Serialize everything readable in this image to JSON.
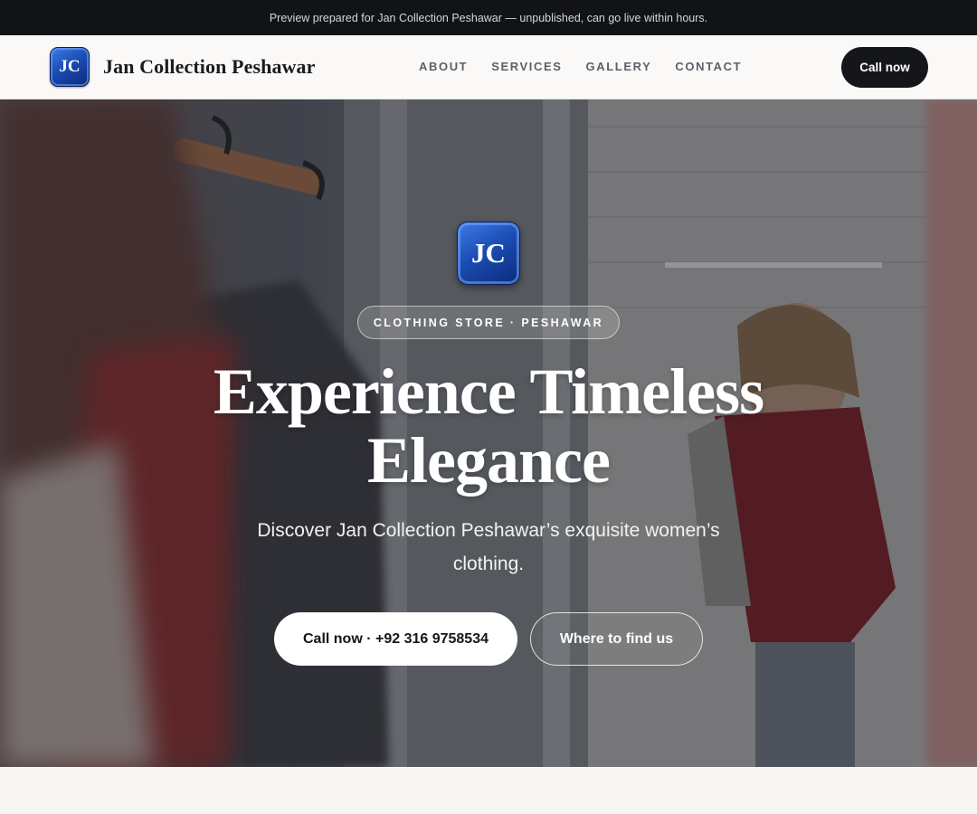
{
  "banner": {
    "text": "Preview prepared for Jan Collection Peshawar — unpublished, can go live within hours."
  },
  "header": {
    "logo_initials": "JC",
    "brand_name": "Jan Collection Peshawar",
    "nav": [
      {
        "label": "ABOUT"
      },
      {
        "label": "SERVICES"
      },
      {
        "label": "GALLERY"
      },
      {
        "label": "CONTACT"
      }
    ],
    "call_label": "Call now"
  },
  "hero": {
    "logo_initials": "JC",
    "tag": "CLOTHING STORE · PESHAWAR",
    "headline_line1": "Experience Timeless",
    "headline_line2": "Elegance",
    "subtitle": "Discover Jan Collection Peshawar’s exquisite women’s clothing.",
    "primary_button": "Call now · +92 316 9758534",
    "secondary_button": "Where to find us"
  },
  "colors": {
    "banner_bg": "#111316",
    "header_bg": "#faf9f7",
    "accent_dark": "#15161a",
    "logo_blue": "#1b4db6"
  },
  "icons": {
    "brand_logo": "jc-monogram-badge"
  }
}
